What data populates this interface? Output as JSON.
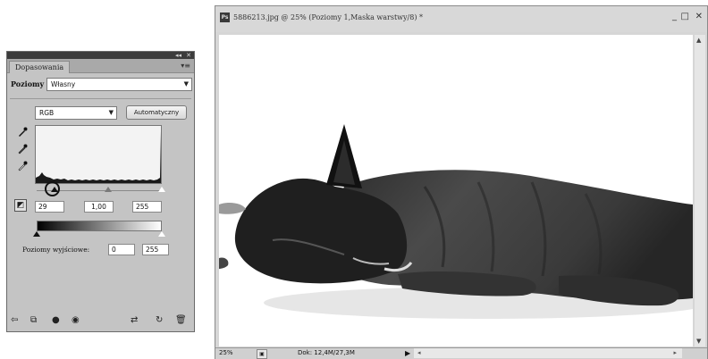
{
  "adjustments_panel": {
    "tab_label": "Dopasowania",
    "collapse_control": "◂◂",
    "close_control": "✕",
    "menu_icon": "▾≡",
    "preset_label": "Poziomy",
    "preset_value": "Własny",
    "channel_value": "RGB",
    "auto_button_label": "Automatyczny",
    "input_black": "29",
    "input_gamma": "1,00",
    "input_white": "255",
    "output_label": "Poziomy wyjściowe:",
    "output_black": "0",
    "output_white": "255",
    "icons": [
      "eyedropper-black-icon",
      "eyedropper-gray-icon",
      "eyedropper-white-icon",
      "clip-layer-icon",
      "back-icon",
      "new-layer-icon",
      "visibility-icon",
      "eye-icon",
      "preview-icon",
      "reset-icon",
      "trash-icon"
    ]
  },
  "document_window": {
    "title": "5886213.jpg @ 25% (Poziomy 1,Maska warstwy/8) *",
    "minimize": "_",
    "maximize": "□",
    "close": "✕",
    "status_zoom": "25%",
    "status_docsize": "Dok: 12,4M/27,3M"
  },
  "colors": {
    "panel_bg": "#c4c4c4",
    "panel_topbar": "#3c3c3c",
    "window_bg": "#d6d6d6",
    "canvas_bg": "#ffffff"
  }
}
